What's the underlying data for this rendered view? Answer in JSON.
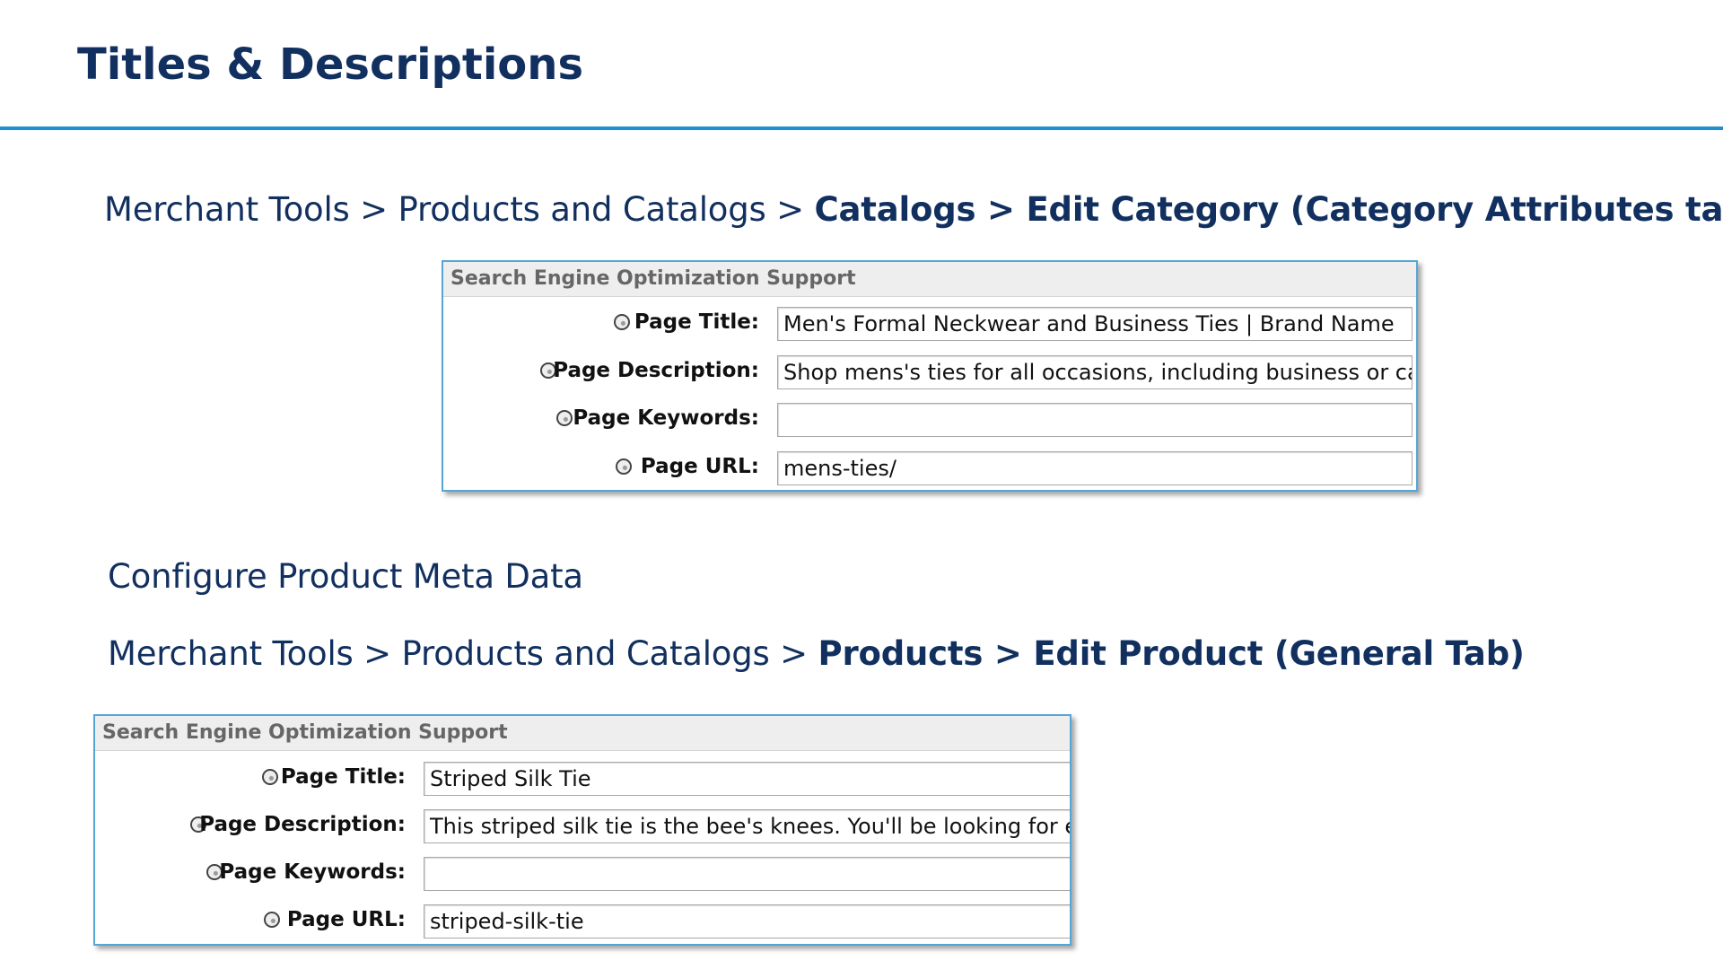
{
  "slide": {
    "title": "Titles & Descriptions"
  },
  "section1": {
    "breadcrumb_plain": "Merchant Tools > Products and Catalogs > ",
    "breadcrumb_bold": "Catalogs > Edit Category (Category Attributes tab)",
    "panel": {
      "header": "Search Engine Optimization Support",
      "rows": [
        {
          "label": "Page Title:",
          "value": "Men's Formal Neckwear and Business Ties | Brand Name"
        },
        {
          "label": "Page Description:",
          "value": "Shop mens's ties for all occasions, including business or cas"
        },
        {
          "label": "Page Keywords:",
          "value": ""
        },
        {
          "label": "Page URL:",
          "value": "mens-ties/"
        }
      ]
    }
  },
  "section2": {
    "subhead": "Configure Product Meta Data",
    "breadcrumb_plain": "Merchant Tools > Products and Catalogs > ",
    "breadcrumb_bold": "Products > Edit Product (General Tab)",
    "panel": {
      "header": "Search Engine Optimization Support",
      "rows": [
        {
          "label": "Page Title:",
          "value": "Striped Silk Tie"
        },
        {
          "label": "Page Description:",
          "value": "This striped silk tie is the bee's knees. You'll be looking for exc"
        },
        {
          "label": "Page Keywords:",
          "value": ""
        },
        {
          "label": "Page URL:",
          "value": "striped-silk-tie"
        }
      ]
    }
  },
  "icons": {
    "help": "help-icon"
  },
  "colors": {
    "title": "#12305f",
    "rule": "#1f8fd1",
    "panel_border": "#55a6d6"
  }
}
